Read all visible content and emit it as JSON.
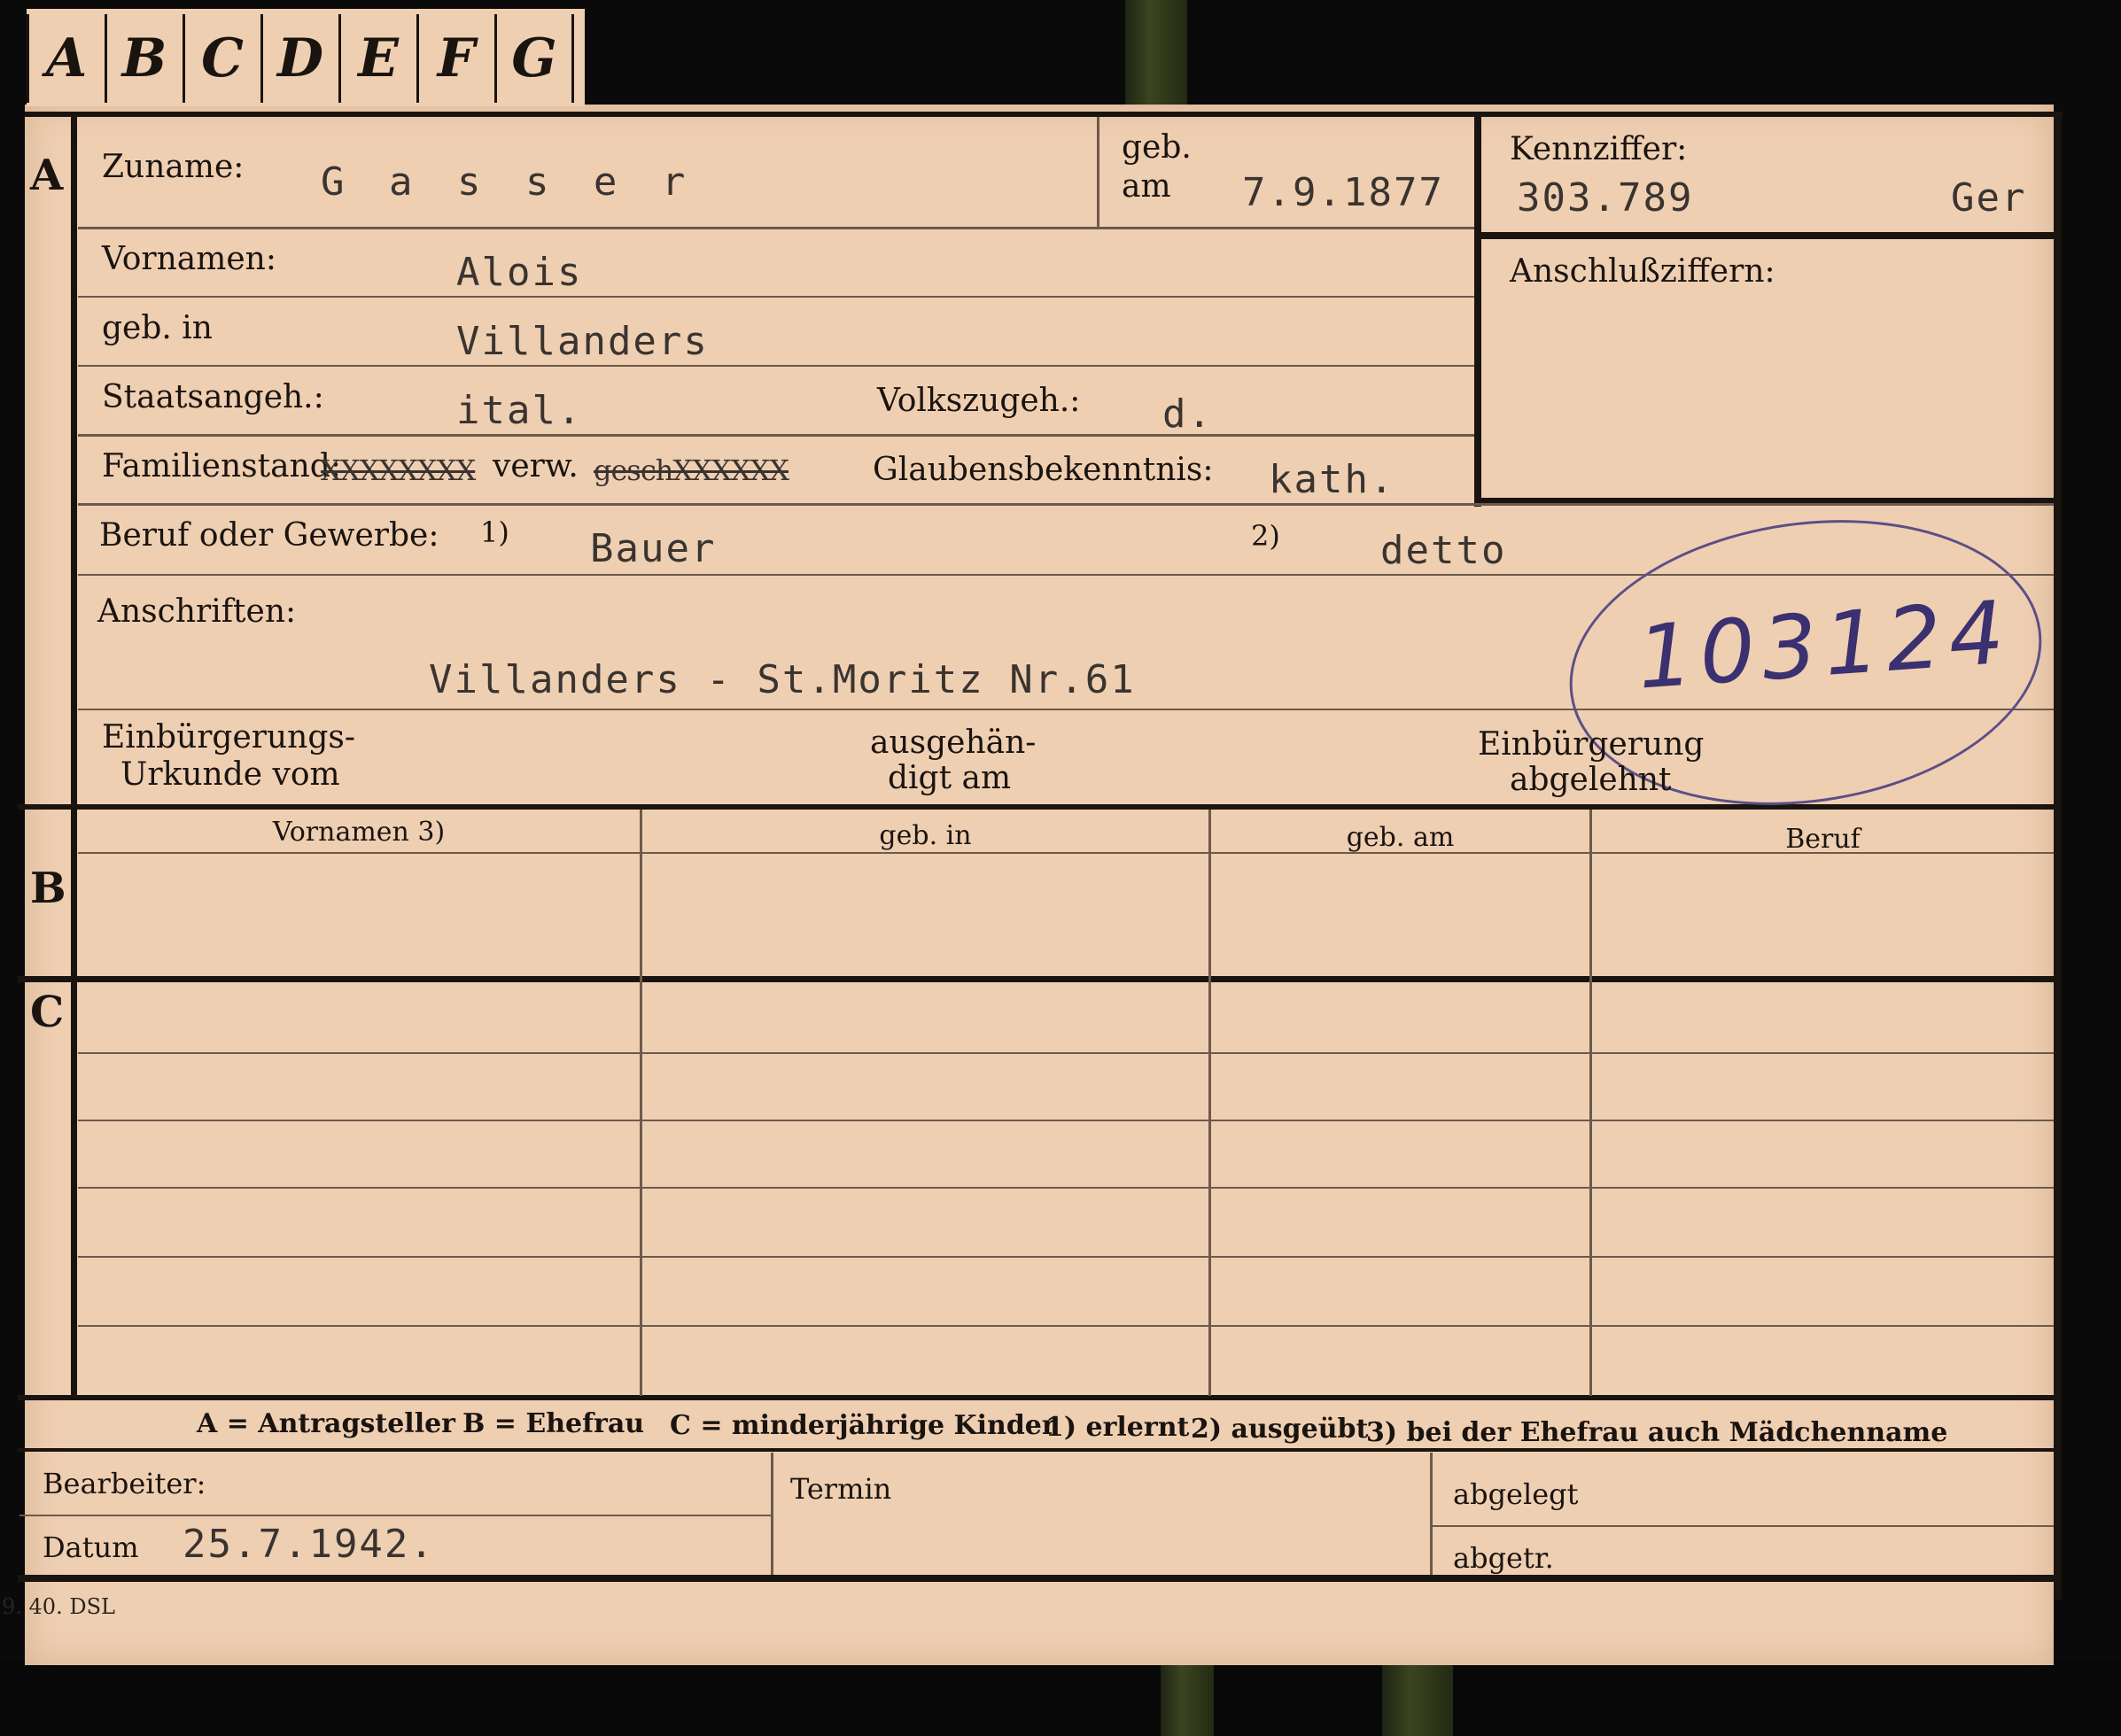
{
  "tabs": [
    "A",
    "B",
    "C",
    "D",
    "E",
    "F",
    "G"
  ],
  "sections": {
    "a": "A",
    "b": "B",
    "c": "C"
  },
  "header": {
    "surname_label": "Zuname:",
    "surname_value": "G a s s e r",
    "born_label_1": "geb.",
    "born_label_2": "am",
    "born_value": "7.9.1877",
    "id_label": "Kennziffer:",
    "id_value": "303.789",
    "id_suffix": "Ger",
    "attach_label": "Anschlußziffern:"
  },
  "person": {
    "firstnames_label": "Vornamen:",
    "firstnames_value": "Alois",
    "birthplace_label": "geb. in",
    "birthplace_value": "Villanders",
    "citizenship_label": "Staatsangeh.:",
    "citizenship_value": "ital.",
    "ethnicity_label": "Volkszugeh.:",
    "ethnicity_value": "d.",
    "marital_label": "Familienstand:",
    "marital_struck_1": "XXXXXXXX",
    "marital_selected": "verw.",
    "marital_struck_2": "geschXXXXXX",
    "religion_label": "Glaubensbekenntnis:",
    "religion_value": "kath.",
    "occupation_label": "Beruf oder Gewerbe:",
    "occ_mark_1": "1)",
    "occupation_1": "Bauer",
    "occ_mark_2": "2)",
    "occupation_2": "detto",
    "address_label": "Anschriften:",
    "address_value": "Villanders - St.Moritz Nr.61",
    "handwritten_number": "103124"
  },
  "naturalization": {
    "certificate_label_1": "Einbürgerungs-",
    "certificate_label_2": "Urkunde vom",
    "handed_label_1": "ausgehän-",
    "handed_label_2": "digt am",
    "denied_label_1": "Einbürgerung",
    "denied_label_2": "abgelehnt"
  },
  "table_columns": [
    "Vornamen 3)",
    "geb. in",
    "geb. am",
    "Beruf"
  ],
  "legend": {
    "a": "A = Antragsteller",
    "b": "B = Ehefrau",
    "c": "C = minderjährige Kinder",
    "n1": "1) erlernt",
    "n2": "2) ausgeübt",
    "n3": "3) bei der Ehefrau auch Mädchenname"
  },
  "footer": {
    "clerk_label": "Bearbeiter:",
    "date_label": "Datum",
    "date_value": "25.7.1942.",
    "deadline_label": "Termin",
    "filed_label": "abgelegt",
    "sent_label": "abgetr.",
    "print_code": "9. 40. DSL"
  }
}
